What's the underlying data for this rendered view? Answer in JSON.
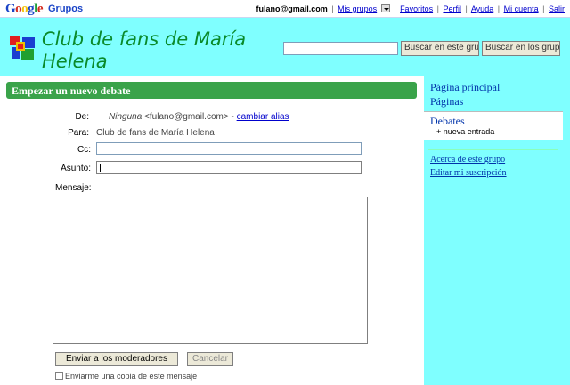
{
  "header": {
    "logo": "Google",
    "product": "Grupos",
    "email": "fulano@gmail.com",
    "links": {
      "my_groups": "Mis grupos",
      "favorites": "Favoritos",
      "profile": "Perfil",
      "help": "Ayuda",
      "account": "Mi cuenta",
      "signout": "Salir"
    },
    "separator": "|"
  },
  "group": {
    "title": "Club de fans de María Helena",
    "search_input_value": "",
    "search_group_button": "Buscar en este grupo",
    "search_all_button": "Buscar en los grupos"
  },
  "sidebar": {
    "home": "Página principal",
    "pages": "Páginas",
    "debates": "Debates",
    "new_entry": "+ nueva entrada",
    "about": "Acerca de este grupo",
    "subscription": "Editar mi suscripción"
  },
  "form": {
    "title": "Empezar un nuevo debate",
    "from_label": "De:",
    "from_name": "Ninguna",
    "from_email": "<fulano@gmail.com>",
    "from_dash": "-",
    "change_alias": "cambiar alias",
    "to_label": "Para:",
    "to_value": "Club de fans de María Helena",
    "cc_label": "Cc:",
    "cc_value": "",
    "subject_label": "Asunto:",
    "subject_value": "",
    "message_label": "Mensaje:",
    "message_value": "",
    "send_button": "Enviar a los moderadores",
    "cancel_button": "Cancelar",
    "copy_label": "Enviarme una copia de este mensaje",
    "copy_checked": false
  },
  "colors": {
    "group_bg": "#7fffff",
    "header_green": "#3aa34a",
    "title_green": "#0a8a2a",
    "link_blue": "#0033aa"
  },
  "icons": [
    "group-logo-icon",
    "dropdown-arrow-icon"
  ]
}
